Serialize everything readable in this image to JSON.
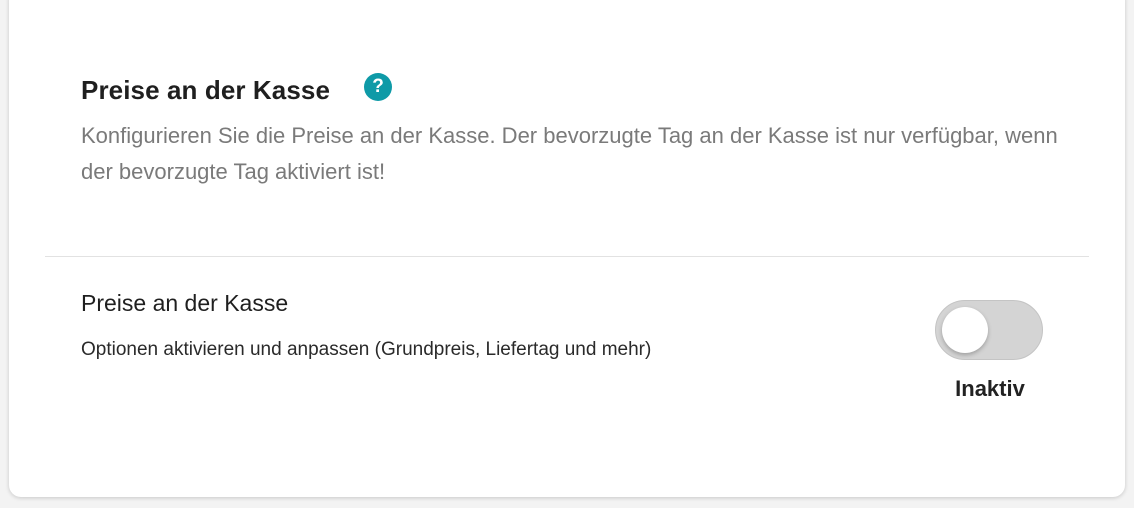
{
  "section": {
    "title": "Preise an der Kasse",
    "help_icon": "question-circle-icon",
    "help_label": "?",
    "description": "Konfigurieren Sie die Preise an der Kasse. Der bevorzugte Tag an der Kasse ist nur verfügbar, wenn der bevorzugte Tag aktiviert ist!"
  },
  "setting": {
    "title": "Preise an der Kasse",
    "description": "Optionen aktivieren und anpassen (Grundpreis, Liefertag und mehr)",
    "toggle_on": false,
    "status": "Inaktiv"
  },
  "colors": {
    "accent": "#0e9aa7",
    "toggle_off": "#d4d4d4"
  }
}
